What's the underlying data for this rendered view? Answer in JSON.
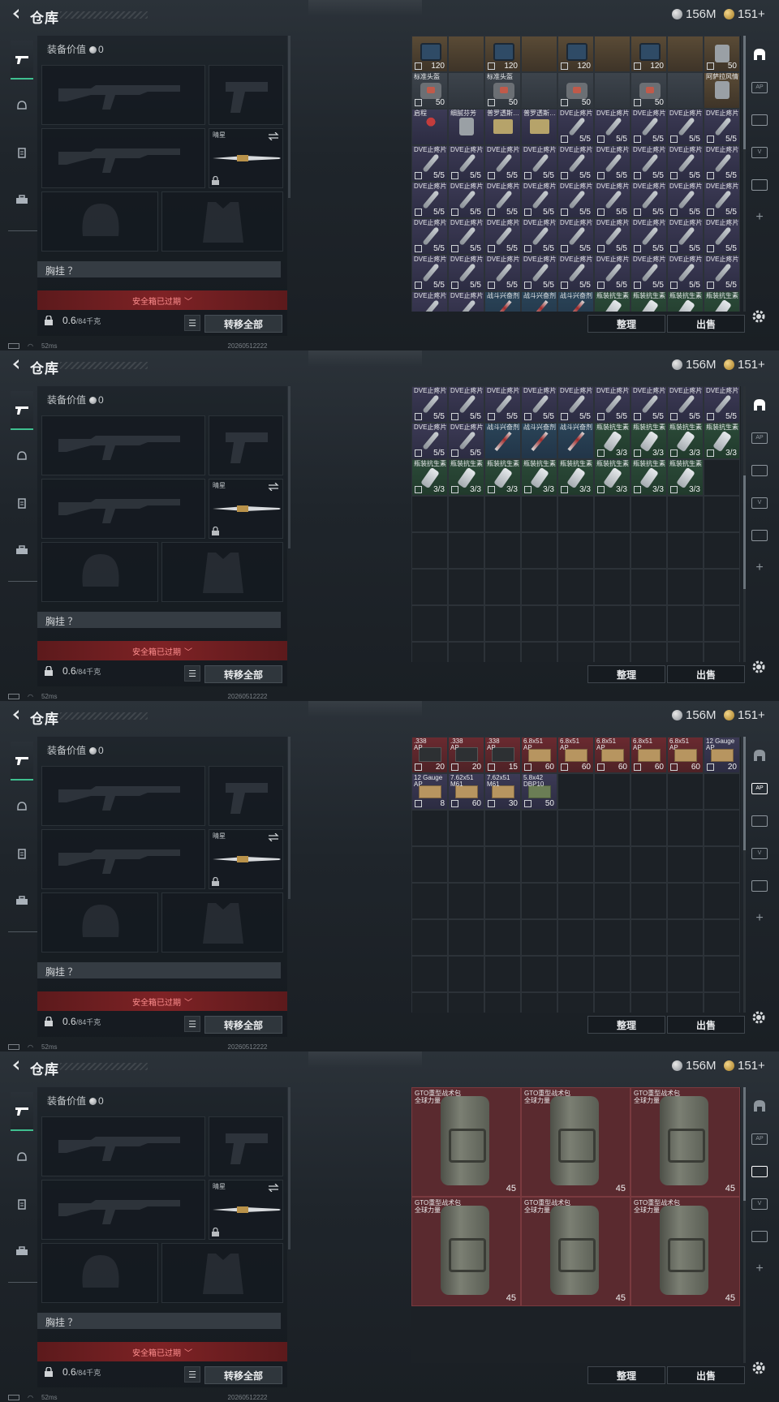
{
  "header": {
    "title": "仓库",
    "silver": "156M",
    "gold": "151+"
  },
  "left": {
    "equip_value_label": "装备价值",
    "equip_value": "0",
    "knife_label": "晴星",
    "chest_label": "胸挂 ？",
    "safebox_expired": "安全箱已过期",
    "weight": "0.6",
    "weight_max": "/84千克",
    "transfer_all": "转移全部"
  },
  "buttons": {
    "sort": "整理",
    "sell": "出售"
  },
  "status": {
    "ping": "52ms",
    "code": "20260512222"
  },
  "panels": [
    {
      "active_right_tab": 0,
      "scroll_fraction": 0.0,
      "mode": "items",
      "items": [
        {
          "name": "",
          "count": "120",
          "bg": "brown",
          "art": "case"
        },
        {
          "name": "",
          "count": "",
          "bg": "brown",
          "art": ""
        },
        {
          "name": "",
          "count": "120",
          "bg": "brown",
          "art": "case"
        },
        {
          "name": "",
          "count": "",
          "bg": "brown",
          "art": ""
        },
        {
          "name": "",
          "count": "120",
          "bg": "brown",
          "art": "case"
        },
        {
          "name": "",
          "count": "",
          "bg": "brown",
          "art": ""
        },
        {
          "name": "",
          "count": "120",
          "bg": "brown",
          "art": "case"
        },
        {
          "name": "",
          "count": "",
          "bg": "brown",
          "art": ""
        },
        {
          "name": "",
          "count": "50",
          "bg": "brown",
          "art": "jar"
        },
        {
          "name": "标准头盔",
          "count": "50",
          "bg": "grey",
          "art": "bag"
        },
        {
          "name": "",
          "count": "",
          "bg": "grey",
          "art": ""
        },
        {
          "name": "标准头盔",
          "count": "50",
          "bg": "grey",
          "art": "bag"
        },
        {
          "name": "",
          "count": "",
          "bg": "grey",
          "art": ""
        },
        {
          "name": "",
          "count": "50",
          "bg": "grey",
          "art": "bag"
        },
        {
          "name": "",
          "count": "",
          "bg": "grey",
          "art": ""
        },
        {
          "name": "",
          "count": "50",
          "bg": "grey",
          "art": "bag"
        },
        {
          "name": "",
          "count": "",
          "bg": "grey",
          "art": ""
        },
        {
          "name": "阿萨拉风情",
          "count": "",
          "bg": "brown",
          "art": "jar"
        },
        {
          "name": "启程",
          "count": "",
          "bg": "purple",
          "art": "glass"
        },
        {
          "name": "细腻芬芳",
          "count": "",
          "bg": "purple",
          "art": "jar"
        },
        {
          "name": "普罗透斯…",
          "count": "",
          "bg": "purple",
          "art": "pack"
        },
        {
          "name": "普罗透斯…",
          "count": "",
          "bg": "purple",
          "art": "pack"
        },
        {
          "name": "DVE止疼片",
          "count": "5/5",
          "bg": "purple",
          "art": "pill"
        },
        {
          "name": "DVE止疼片",
          "count": "5/5",
          "bg": "purple",
          "art": "pill"
        },
        {
          "name": "DVE止疼片",
          "count": "5/5",
          "bg": "purple",
          "art": "pill"
        },
        {
          "name": "DVE止疼片",
          "count": "5/5",
          "bg": "purple",
          "art": "pill"
        },
        {
          "name": "DVE止疼片",
          "count": "5/5",
          "bg": "purple",
          "art": "pill"
        },
        {
          "name": "DVE止疼片",
          "count": "5/5",
          "bg": "purple",
          "art": "pill"
        },
        {
          "name": "DVE止疼片",
          "count": "5/5",
          "bg": "purple",
          "art": "pill"
        },
        {
          "name": "DVE止疼片",
          "count": "5/5",
          "bg": "purple",
          "art": "pill"
        },
        {
          "name": "DVE止疼片",
          "count": "5/5",
          "bg": "purple",
          "art": "pill"
        },
        {
          "name": "DVE止疼片",
          "count": "5/5",
          "bg": "purple",
          "art": "pill"
        },
        {
          "name": "DVE止疼片",
          "count": "5/5",
          "bg": "purple",
          "art": "pill"
        },
        {
          "name": "DVE止疼片",
          "count": "5/5",
          "bg": "purple",
          "art": "pill"
        },
        {
          "name": "DVE止疼片",
          "count": "5/5",
          "bg": "purple",
          "art": "pill"
        },
        {
          "name": "DVE止疼片",
          "count": "5/5",
          "bg": "purple",
          "art": "pill"
        },
        {
          "name": "DVE止疼片",
          "count": "5/5",
          "bg": "purple",
          "art": "pill"
        },
        {
          "name": "DVE止疼片",
          "count": "5/5",
          "bg": "purple",
          "art": "pill"
        },
        {
          "name": "DVE止疼片",
          "count": "5/5",
          "bg": "purple",
          "art": "pill"
        },
        {
          "name": "DVE止疼片",
          "count": "5/5",
          "bg": "purple",
          "art": "pill"
        },
        {
          "name": "DVE止疼片",
          "count": "5/5",
          "bg": "purple",
          "art": "pill"
        },
        {
          "name": "DVE止疼片",
          "count": "5/5",
          "bg": "purple",
          "art": "pill"
        },
        {
          "name": "DVE止疼片",
          "count": "5/5",
          "bg": "purple",
          "art": "pill"
        },
        {
          "name": "DVE止疼片",
          "count": "5/5",
          "bg": "purple",
          "art": "pill"
        },
        {
          "name": "DVE止疼片",
          "count": "5/5",
          "bg": "purple",
          "art": "pill"
        },
        {
          "name": "DVE止疼片",
          "count": "5/5",
          "bg": "purple",
          "art": "pill"
        },
        {
          "name": "DVE止疼片",
          "count": "5/5",
          "bg": "purple",
          "art": "pill"
        },
        {
          "name": "DVE止疼片",
          "count": "5/5",
          "bg": "purple",
          "art": "pill"
        },
        {
          "name": "DVE止疼片",
          "count": "5/5",
          "bg": "purple",
          "art": "pill"
        },
        {
          "name": "DVE止疼片",
          "count": "5/5",
          "bg": "purple",
          "art": "pill"
        },
        {
          "name": "DVE止疼片",
          "count": "5/5",
          "bg": "purple",
          "art": "pill"
        },
        {
          "name": "DVE止疼片",
          "count": "5/5",
          "bg": "purple",
          "art": "pill"
        },
        {
          "name": "DVE止疼片",
          "count": "5/5",
          "bg": "purple",
          "art": "pill"
        },
        {
          "name": "DVE止疼片",
          "count": "5/5",
          "bg": "purple",
          "art": "pill"
        },
        {
          "name": "DVE止疼片",
          "count": "5/5",
          "bg": "purple",
          "art": "pill"
        },
        {
          "name": "DVE止疼片",
          "count": "5/5",
          "bg": "purple",
          "art": "pill"
        },
        {
          "name": "DVE止疼片",
          "count": "5/5",
          "bg": "purple",
          "art": "pill"
        },
        {
          "name": "DVE止疼片",
          "count": "5/5",
          "bg": "purple",
          "art": "pill"
        },
        {
          "name": "DVE止疼片",
          "count": "5/5",
          "bg": "purple",
          "art": "pill"
        },
        {
          "name": "DVE止疼片",
          "count": "5/5",
          "bg": "purple",
          "art": "pill"
        },
        {
          "name": "DVE止疼片",
          "count": "5/5",
          "bg": "purple",
          "art": "pill"
        },
        {
          "name": "DVE止疼片",
          "count": "5/5",
          "bg": "purple",
          "art": "pill"
        },
        {
          "name": "DVE止疼片",
          "count": "5/5",
          "bg": "purple",
          "art": "pill"
        },
        {
          "name": "DVE止疼片",
          "count": "5/5",
          "bg": "purple",
          "art": "pill"
        },
        {
          "name": "DVE止疼片",
          "count": "5/5",
          "bg": "purple",
          "art": "pill"
        },
        {
          "name": "战斗兴奋剂",
          "count": "",
          "bg": "blue",
          "art": "syr"
        },
        {
          "name": "战斗兴奋剂",
          "count": "",
          "bg": "blue",
          "art": "syr"
        },
        {
          "name": "战斗兴奋剂",
          "count": "",
          "bg": "blue",
          "art": "syr"
        },
        {
          "name": "瓶装抗生素",
          "count": "3/3",
          "bg": "green",
          "art": "bottle"
        },
        {
          "name": "瓶装抗生素",
          "count": "3/3",
          "bg": "green",
          "art": "bottle"
        },
        {
          "name": "瓶装抗生素",
          "count": "3/3",
          "bg": "green",
          "art": "bottle"
        },
        {
          "name": "瓶装抗生素",
          "count": "3/3",
          "bg": "green",
          "art": "bottle"
        },
        {
          "name": "瓶装抗生素",
          "count": "",
          "bg": "green",
          "art": "bottle"
        },
        {
          "name": "瓶装抗生素",
          "count": "",
          "bg": "green",
          "art": "bottle"
        },
        {
          "name": "瓶装抗生素",
          "count": "",
          "bg": "green",
          "art": "bottle"
        },
        {
          "name": "瓶装抗生素",
          "count": "",
          "bg": "green",
          "art": "bottle"
        },
        {
          "name": "瓶装抗生素",
          "count": "",
          "bg": "green",
          "art": "bottle"
        },
        {
          "name": "瓶装抗生素",
          "count": "",
          "bg": "green",
          "art": "bottle"
        },
        {
          "name": "瓶装抗生素",
          "count": "",
          "bg": "green",
          "art": "bottle"
        },
        {
          "name": "瓶装抗生素",
          "count": "",
          "bg": "green",
          "art": "bottle"
        },
        {
          "name": "瓶装抗生素",
          "count": "",
          "bg": "green",
          "art": "bottle"
        }
      ]
    },
    {
      "active_right_tab": 0,
      "scroll_fraction": 0.55,
      "mode": "items",
      "items": [
        {
          "name": "DVE止疼片",
          "count": "5/5",
          "bg": "purple",
          "art": "pill"
        },
        {
          "name": "DVE止疼片",
          "count": "5/5",
          "bg": "purple",
          "art": "pill"
        },
        {
          "name": "DVE止疼片",
          "count": "5/5",
          "bg": "purple",
          "art": "pill"
        },
        {
          "name": "DVE止疼片",
          "count": "5/5",
          "bg": "purple",
          "art": "pill"
        },
        {
          "name": "DVE止疼片",
          "count": "5/5",
          "bg": "purple",
          "art": "pill"
        },
        {
          "name": "DVE止疼片",
          "count": "5/5",
          "bg": "purple",
          "art": "pill"
        },
        {
          "name": "DVE止疼片",
          "count": "5/5",
          "bg": "purple",
          "art": "pill"
        },
        {
          "name": "DVE止疼片",
          "count": "5/5",
          "bg": "purple",
          "art": "pill"
        },
        {
          "name": "DVE止疼片",
          "count": "5/5",
          "bg": "purple",
          "art": "pill"
        },
        {
          "name": "DVE止疼片",
          "count": "5/5",
          "bg": "purple",
          "art": "pill"
        },
        {
          "name": "DVE止疼片",
          "count": "5/5",
          "bg": "purple",
          "art": "pill"
        },
        {
          "name": "战斗兴奋剂",
          "count": "",
          "bg": "blue",
          "art": "syr"
        },
        {
          "name": "战斗兴奋剂",
          "count": "",
          "bg": "blue",
          "art": "syr"
        },
        {
          "name": "战斗兴奋剂",
          "count": "",
          "bg": "blue",
          "art": "syr"
        },
        {
          "name": "瓶装抗生素",
          "count": "3/3",
          "bg": "green",
          "art": "bottle"
        },
        {
          "name": "瓶装抗生素",
          "count": "3/3",
          "bg": "green",
          "art": "bottle"
        },
        {
          "name": "瓶装抗生素",
          "count": "3/3",
          "bg": "green",
          "art": "bottle"
        },
        {
          "name": "瓶装抗生素",
          "count": "3/3",
          "bg": "green",
          "art": "bottle"
        },
        {
          "name": "瓶装抗生素",
          "count": "3/3",
          "bg": "green",
          "art": "bottle"
        },
        {
          "name": "瓶装抗生素",
          "count": "3/3",
          "bg": "green",
          "art": "bottle"
        },
        {
          "name": "瓶装抗生素",
          "count": "3/3",
          "bg": "green",
          "art": "bottle"
        },
        {
          "name": "瓶装抗生素",
          "count": "3/3",
          "bg": "green",
          "art": "bottle"
        },
        {
          "name": "瓶装抗生素",
          "count": "3/3",
          "bg": "green",
          "art": "bottle"
        },
        {
          "name": "瓶装抗生素",
          "count": "3/3",
          "bg": "green",
          "art": "bottle"
        },
        {
          "name": "瓶装抗生素",
          "count": "3/3",
          "bg": "green",
          "art": "bottle"
        },
        {
          "name": "瓶装抗生素",
          "count": "3/3",
          "bg": "green",
          "art": "bottle"
        }
      ]
    },
    {
      "active_right_tab": 1,
      "scroll_fraction": 0.0,
      "mode": "items",
      "items": [
        {
          "name": ".338\nAP",
          "count": "20",
          "bg": "red",
          "art": "ammo-dark"
        },
        {
          "name": ".338\nAP",
          "count": "20",
          "bg": "red",
          "art": "ammo-dark"
        },
        {
          "name": ".338\nAP",
          "count": "15",
          "bg": "red",
          "art": "ammo-dark"
        },
        {
          "name": "6.8x51\nAP",
          "count": "60",
          "bg": "red",
          "art": "ammo-tan"
        },
        {
          "name": "6.8x51\nAP",
          "count": "60",
          "bg": "red",
          "art": "ammo-tan"
        },
        {
          "name": "6.8x51\nAP",
          "count": "60",
          "bg": "red",
          "art": "ammo-tan"
        },
        {
          "name": "6.8x51\nAP",
          "count": "60",
          "bg": "red",
          "art": "ammo-tan"
        },
        {
          "name": "6.8x51\nAP",
          "count": "60",
          "bg": "red",
          "art": "ammo-tan"
        },
        {
          "name": "12 Gauge\nAP",
          "count": "20",
          "bg": "purple",
          "art": "ammo-tan"
        },
        {
          "name": "12 Gauge\nAP",
          "count": "8",
          "bg": "purple",
          "art": "ammo-tan"
        },
        {
          "name": "7.62x51\nM61",
          "count": "60",
          "bg": "purple",
          "art": "ammo-tan"
        },
        {
          "name": "7.62x51\nM61",
          "count": "30",
          "bg": "purple",
          "art": "ammo-tan"
        },
        {
          "name": "5.8x42\nDBP10",
          "count": "50",
          "bg": "purple",
          "art": "ammo-green"
        }
      ]
    },
    {
      "active_right_tab": 2,
      "scroll_fraction": 0.0,
      "mode": "bags",
      "items": [
        {
          "name": "GTO重型战术包\n全球力量",
          "count": "45"
        },
        {
          "name": "GTO重型战术包\n全球力量",
          "count": "45"
        },
        {
          "name": "GTO重型战术包\n全球力量",
          "count": "45"
        },
        {
          "name": "GTO重型战术包\n全球力量",
          "count": "45"
        },
        {
          "name": "GTO重型战术包\n全球力量",
          "count": "45"
        },
        {
          "name": "GTO重型战术包\n全球力量",
          "count": "45"
        }
      ]
    }
  ],
  "right_tabs": [
    "shield-icon",
    "ammo-tab-icon",
    "backpack-tab-icon",
    "vest-tab-icon",
    "weapons-tab-icon",
    "plus-icon"
  ],
  "colors": {
    "accent_green": "#3fbf8f",
    "expired_red": "#7e2225"
  }
}
